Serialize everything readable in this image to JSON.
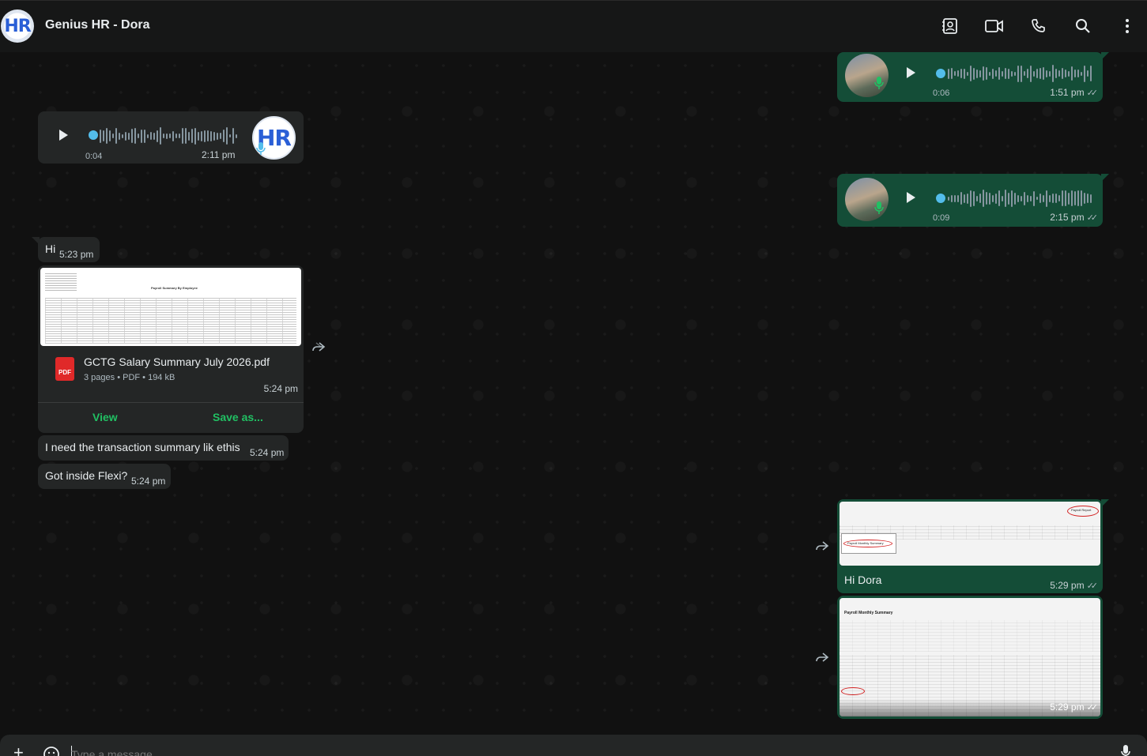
{
  "header": {
    "title": "Genius HR - Dora",
    "avatar_text": "HR",
    "icons": [
      "contact-card-icon",
      "video-call-icon",
      "phone-call-icon",
      "search-icon",
      "more-menu-icon"
    ]
  },
  "messages": {
    "voice_out_1": {
      "duration": "0:06",
      "time": "1:51 pm"
    },
    "voice_in_1": {
      "duration": "0:04",
      "time": "2:11 pm"
    },
    "voice_out_2": {
      "duration": "0:09",
      "time": "2:15 pm"
    },
    "text_hi": {
      "text": "Hi",
      "time": "5:23 pm"
    },
    "document": {
      "filename": "GCTG Salary Summary July 2026.pdf",
      "meta": "3 pages • PDF • 194 kB",
      "time": "5:24 pm",
      "pdf_label": "PDF",
      "preview_title": "Payroll Summary By Employee",
      "view_label": "View",
      "save_label": "Save as..."
    },
    "text_need": {
      "text": "I need the transaction summary lik ethis",
      "time": "5:24 pm"
    },
    "text_flexi": {
      "text": "Got inside Flexi?",
      "time": "5:24 pm"
    },
    "image_out_1": {
      "caption": "Hi Dora",
      "time": "5:29 pm",
      "menu_item": "Payroll Monthly Summary",
      "tab_label": "Payroll Report"
    },
    "image_out_2": {
      "time": "5:29 pm",
      "title": "Payroll Monthly Summary"
    }
  },
  "composer": {
    "placeholder": "Type a message"
  },
  "colors": {
    "incoming_bubble": "#242626",
    "outgoing_bubble": "#144d37",
    "accent_green": "#21c063",
    "voice_dot_blue": "#53bdeb"
  }
}
